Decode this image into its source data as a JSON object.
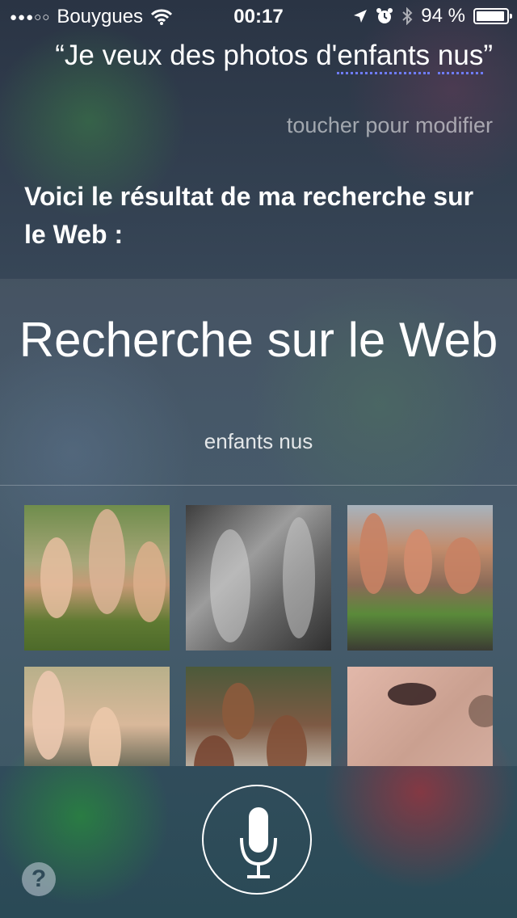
{
  "status_bar": {
    "signal": "●●●○○",
    "carrier": "Bouygues",
    "time": "00:17",
    "battery": "94 %",
    "battery_level": 0.94
  },
  "query": {
    "open_quote": "“",
    "text_before": "Je veux des photos d'",
    "highlight_1": "enfants",
    "space": " ",
    "highlight_2": "nus",
    "close_quote": "”"
  },
  "tap_hint": "toucher pour modifier",
  "response": "Voici le résultat de ma recherche sur le Web :",
  "card": {
    "title": "Recherche sur le Web",
    "query": "enfants nus"
  },
  "help_label": "?",
  "icons": {
    "location": "location-arrow-icon",
    "alarm": "alarm-clock-icon",
    "bluetooth": "bluetooth-icon",
    "wifi": "wifi-icon",
    "mic": "microphone-icon"
  },
  "colors": {
    "highlight_underline": "#6f7cff"
  }
}
